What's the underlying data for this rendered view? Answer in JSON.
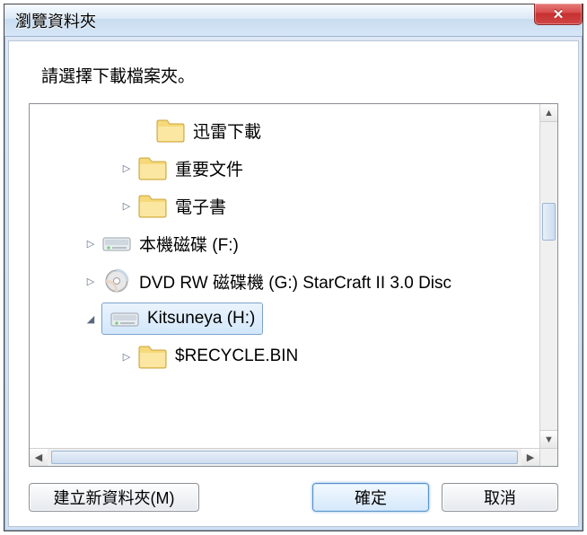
{
  "window": {
    "title": "瀏覽資料夾",
    "close_glyph": "✕"
  },
  "instruction": "請選擇下載檔案夾。",
  "tree": {
    "items": [
      {
        "icon": "folder",
        "expander": "none",
        "indent": 112,
        "label": "迅雷下載",
        "selected": false
      },
      {
        "icon": "folder",
        "expander": "collapsed",
        "indent": 92,
        "label": "重要文件",
        "selected": false
      },
      {
        "icon": "folder",
        "expander": "collapsed",
        "indent": 92,
        "label": "電子書",
        "selected": false
      },
      {
        "icon": "hdd",
        "expander": "collapsed",
        "indent": 52,
        "label": "本機磁碟 (F:)",
        "selected": false
      },
      {
        "icon": "dvd",
        "expander": "collapsed",
        "indent": 52,
        "label": "DVD RW 磁碟機 (G:) StarCraft II 3.0 Disc",
        "selected": false
      },
      {
        "icon": "hdd",
        "expander": "expanded",
        "indent": 52,
        "label": "Kitsuneya (H:)",
        "selected": true
      },
      {
        "icon": "folder",
        "expander": "collapsed",
        "indent": 92,
        "label": "$RECYCLE.BIN",
        "selected": false
      }
    ]
  },
  "buttons": {
    "new_folder": "建立新資料夾(M)",
    "ok": "確定",
    "cancel": "取消"
  }
}
